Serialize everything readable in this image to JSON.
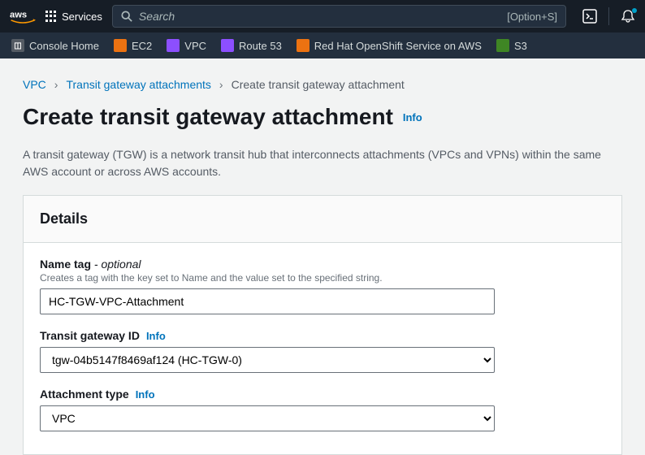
{
  "topnav": {
    "services_label": "Services",
    "search_placeholder": "Search",
    "shortcut": "[Option+S]"
  },
  "secnav": {
    "items": [
      {
        "label": "Console Home",
        "bg": "#545b64"
      },
      {
        "label": "EC2",
        "bg": "#ec7211"
      },
      {
        "label": "VPC",
        "bg": "#8c4fff"
      },
      {
        "label": "Route 53",
        "bg": "#8c4fff"
      },
      {
        "label": "Red Hat OpenShift Service on AWS",
        "bg": "#ec7211"
      },
      {
        "label": "S3",
        "bg": "#3f8624"
      }
    ]
  },
  "breadcrumbs": {
    "a": "VPC",
    "b": "Transit gateway attachments",
    "c": "Create transit gateway attachment"
  },
  "page": {
    "title": "Create transit gateway attachment",
    "info": "Info",
    "desc": "A transit gateway (TGW) is a network transit hub that interconnects attachments (VPCs and VPNs) within the same AWS account or across AWS accounts."
  },
  "panel": {
    "title": "Details",
    "name_label": "Name tag",
    "optional": " - optional",
    "name_help": "Creates a tag with the key set to Name and the value set to the specified string.",
    "name_value": "HC-TGW-VPC-Attachment",
    "tgw_label": "Transit gateway ID",
    "tgw_value": "tgw-04b5147f8469af124 (HC-TGW-0)",
    "att_label": "Attachment type",
    "att_value": "VPC",
    "info": "Info"
  }
}
